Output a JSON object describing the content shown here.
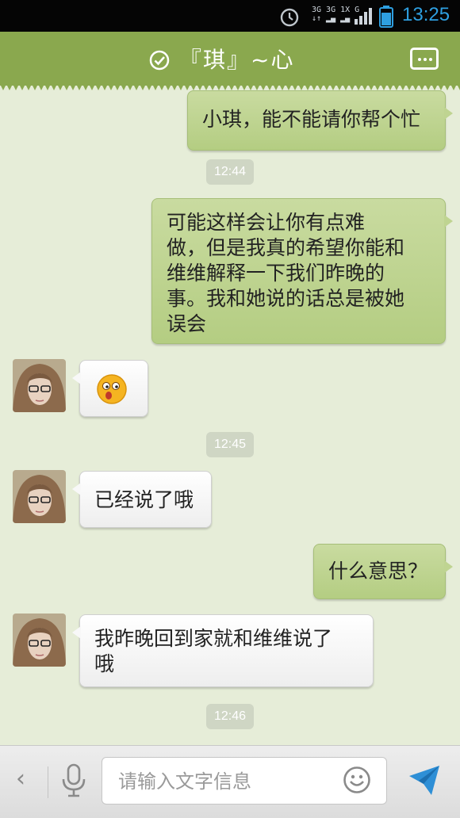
{
  "status": {
    "time": "13:25",
    "network": "3G 3G 1X G"
  },
  "header": {
    "title": "『琪』~心"
  },
  "messages": [
    {
      "side": "out",
      "text": "小琪，能不能请你帮个忙"
    },
    {
      "timestamp": "12:44"
    },
    {
      "side": "out",
      "lines": [
        "可能这样会让你有点难",
        "做，但是我真的希望你能和",
        "维维解释一下我们昨晚的",
        "事。我和她说的话总是被她",
        "误会"
      ]
    },
    {
      "side": "in",
      "emoji": "surprised-face"
    },
    {
      "timestamp": "12:45"
    },
    {
      "side": "in",
      "text": "已经说了哦"
    },
    {
      "side": "out",
      "text": "什么意思？"
    },
    {
      "side": "in",
      "lines": [
        "我昨晚回到家就和维维说了",
        "哦"
      ]
    },
    {
      "timestamp": "12:46"
    }
  ],
  "input": {
    "placeholder": "请输入文字信息"
  },
  "colors": {
    "header": "#8aa84e",
    "chat_bg": "#e6edd8",
    "out_bubble": "#c2d693",
    "in_bubble": "#f5f5f5",
    "clock": "#2e9fe0"
  }
}
